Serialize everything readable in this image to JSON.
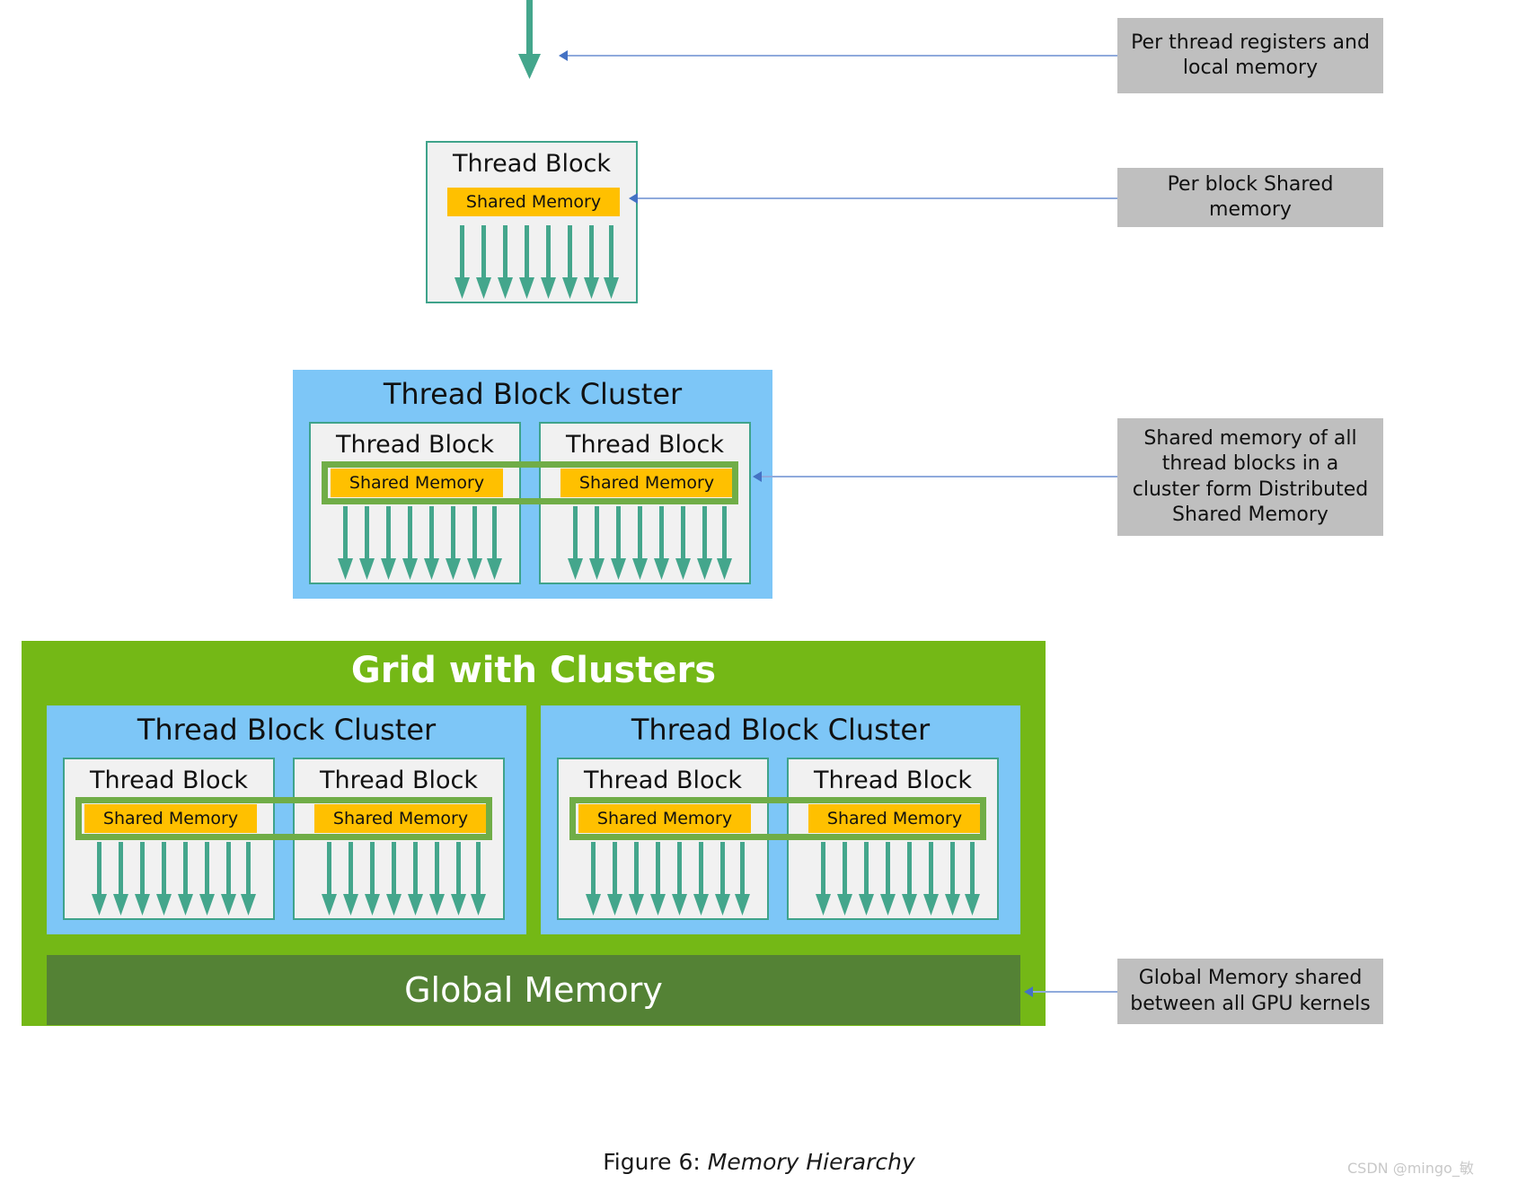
{
  "diagram": {
    "caption_prefix": "Figure 6:",
    "caption_title": "Memory Hierarchy",
    "watermark": "CSDN @mingo_敏"
  },
  "labels": {
    "thread_block": "Thread Block",
    "shared_memory": "Shared Memory",
    "thread_block_cluster": "Thread Block Cluster",
    "grid_with_clusters": "Grid with Clusters",
    "global_memory": "Global Memory"
  },
  "callouts": [
    {
      "id": "per-thread",
      "text": "Per thread registers and local memory"
    },
    {
      "id": "per-block",
      "text": "Per block Shared memory"
    },
    {
      "id": "distributed-shared",
      "text": "Shared memory of all thread blocks in a cluster form Distributed Shared Memory"
    },
    {
      "id": "global",
      "text": "Global Memory shared between all GPU kernels"
    }
  ],
  "colors": {
    "thread_block_fill": "#f1f1f1",
    "thread_block_border": "#3fa38b",
    "shared_memory_fill": "#FFC000",
    "cluster_fill": "#7DC6F7",
    "grid_fill": "#74B816",
    "global_memory_fill": "#548235",
    "arrow_teal": "#44A68C",
    "dsm_outline": "#70AD47",
    "callout_fill": "#BFBFBF",
    "leader_line": "#8faadc"
  },
  "arrows": {
    "per_block_thread_count": 8,
    "top_single_arrow": 1
  }
}
